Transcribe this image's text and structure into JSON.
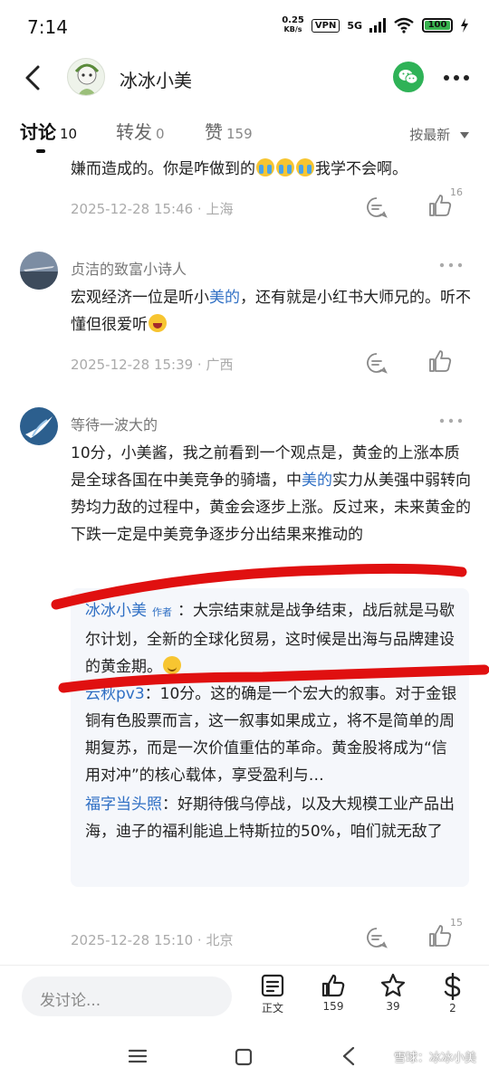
{
  "status": {
    "time": "7:14",
    "net_speed_value": "0.25",
    "net_speed_unit": "KB/s",
    "vpn": "VPN",
    "network": "5G",
    "battery": "100"
  },
  "header": {
    "title": "冰冰小美"
  },
  "tabs": [
    {
      "label": "讨论",
      "count": "10"
    },
    {
      "label": "转发",
      "count": "0"
    },
    {
      "label": "赞",
      "count": "159"
    }
  ],
  "sort_label": "按最新",
  "comments": [
    {
      "text": "嫌而造成的。你是咋做到的",
      "text_after": "我学不会啊。",
      "meta": "2025-12-28 15:46 · 上海",
      "likes": "16"
    },
    {
      "name": "贞洁的致富小诗人",
      "text_a": "宏观经济一位是听小",
      "text_hl": "美的",
      "text_b": "，还有就是小红书大师兄的。听不懂但很爱听",
      "meta": "2025-12-28 15:39 · 广西",
      "likes": ""
    },
    {
      "name": "等待一波大的",
      "text_a": "10分，小美酱，我之前看到一个观点是，黄金的上涨本质是全球各国在中美竞争的骑墙，中",
      "text_hl": "美的",
      "text_b": "实力从美强中弱转向势均力敌的过程中，黄金会逐步上涨。反过来，未来黄金的下跌一定是中美竞争逐步分出结果来推动的",
      "meta": "2025-12-28 15:10 · 北京",
      "likes": "15"
    }
  ],
  "replies": [
    {
      "name": "冰冰小美",
      "tag": "作者",
      "text": "：大宗结束就是战争结束，战后就是马歇尔计划，全新的全球化贸易，这时候是出海与品牌建设的黄金期。"
    },
    {
      "name": "云秋pv3",
      "text": "：10分。这的确是一个宏大的叙事。对于金银铜有色股票而言，这一叙事如果成立，将不是简单的周期复苏，而是一次价值重估的革命。黄金股将成为“信用对冲”的核心载体，享受盈利与…"
    },
    {
      "name": "福字当头照",
      "text": "：好期待俄乌停战，以及大规模工业产品出海，迪子的福利能追上特斯拉的50%，咱们就无敌了"
    }
  ],
  "bottom": {
    "input_placeholder": "发讨论...",
    "actions": [
      {
        "label": "正文",
        "icon": "document-icon"
      },
      {
        "label": "159",
        "icon": "thumb-up-icon"
      },
      {
        "label": "39",
        "icon": "star-icon"
      },
      {
        "label": "2",
        "icon": "dollar-icon"
      }
    ]
  },
  "watermark": "雪球：冰冰小美",
  "colors": {
    "link_blue": "#2f6fc4",
    "wechat_green": "#2fb257",
    "annotation_red": "#e01010"
  }
}
